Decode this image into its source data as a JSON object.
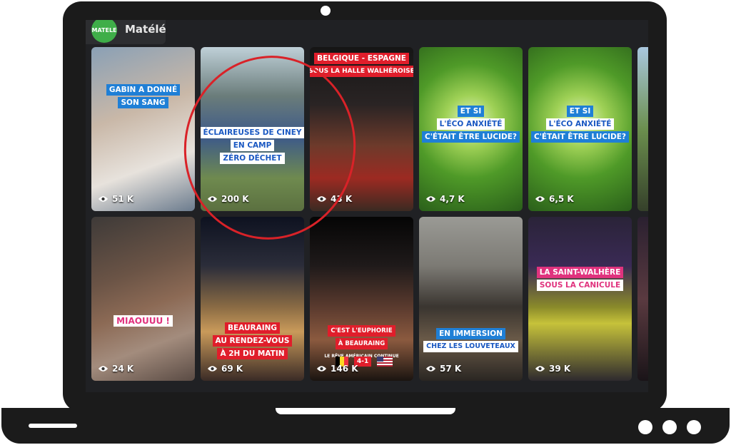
{
  "channel": {
    "logo_text": "MATELE",
    "name": "Matélé"
  },
  "tiles": [
    {
      "id": "t1",
      "views": "51 K",
      "captions": [
        "GABIN A DONNÉ",
        "SON SANG"
      ]
    },
    {
      "id": "t2",
      "views": "200 K",
      "captions": [
        "ÉCLAIREUSES DE CINEY",
        "EN CAMP",
        "ZÉRO DÉCHET"
      ]
    },
    {
      "id": "t3",
      "views": "43 K",
      "captions": [
        "BELGIQUE - ESPAGNE",
        "SOUS LA HALLE WALHÉROISE"
      ]
    },
    {
      "id": "t4",
      "views": "4,7 K",
      "captions": [
        "ET SI",
        "L'ÉCO ANXIÉTÉ",
        "C'ÉTAIT ÊTRE LUCIDE?"
      ]
    },
    {
      "id": "t5",
      "views": "6,5 K",
      "captions": [
        "ET SI",
        "L'ÉCO ANXIÉTÉ",
        "C'ÉTAIT ÊTRE LUCIDE?"
      ]
    },
    {
      "id": "t6",
      "views": "24 K",
      "captions": [
        "MIAOUUU !"
      ]
    },
    {
      "id": "t7",
      "views": "69 K",
      "captions": [
        "BEAURAING",
        "AU RENDEZ-VOUS",
        "À 2H DU MATIN"
      ]
    },
    {
      "id": "t8",
      "views": "146 K",
      "captions": [
        "C'EST L'EUPHORIE",
        "À BEAURAING",
        "LE RÊVE AMÉRICAIN CONTINUE",
        "4-1"
      ]
    },
    {
      "id": "t9",
      "views": "57 K",
      "captions": [
        "EN IMMERSION",
        "CHEZ LES LOUVETEAUX"
      ]
    },
    {
      "id": "t10",
      "views": "39 K",
      "captions": [
        "LA SAINT-WALHÈRE",
        "SOUS LA CANICULE"
      ]
    }
  ],
  "colors": {
    "accent_ring": "#d92228",
    "brand_green": "#3fae49"
  },
  "icons": {
    "views": "eye-icon"
  }
}
